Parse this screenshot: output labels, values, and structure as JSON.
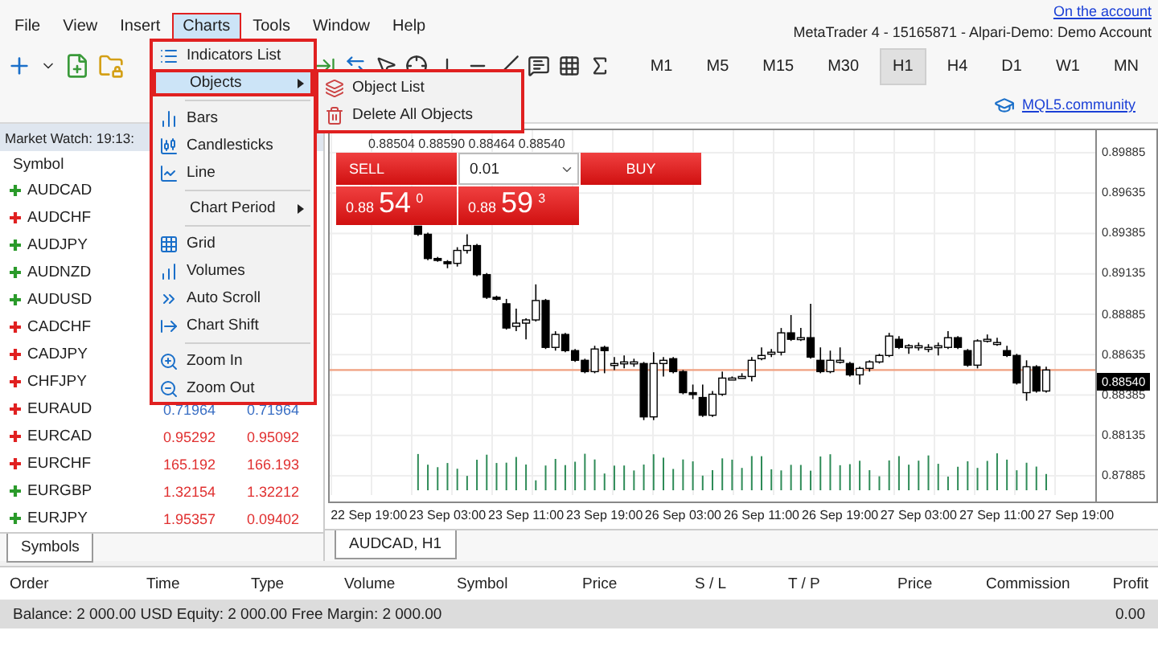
{
  "menu_bar": [
    {
      "label": "File",
      "selected": false
    },
    {
      "label": "View",
      "selected": false
    },
    {
      "label": "Insert",
      "selected": false
    },
    {
      "label": "Charts",
      "selected": true
    },
    {
      "label": "Tools",
      "selected": false
    },
    {
      "label": "Window",
      "selected": false
    },
    {
      "label": "Help",
      "selected": false
    }
  ],
  "account_link": "On the account",
  "window": {
    "title": "MetaTrader 4 - 15165871 - Alpari-Demo: Demo Account"
  },
  "timeframes": [
    {
      "label": "M1",
      "selected": false
    },
    {
      "label": "M5",
      "selected": false
    },
    {
      "label": "M15",
      "selected": false
    },
    {
      "label": "M30",
      "selected": false
    },
    {
      "label": "H1",
      "selected": true
    },
    {
      "label": "H4",
      "selected": false
    },
    {
      "label": "D1",
      "selected": false
    },
    {
      "label": "W1",
      "selected": false
    },
    {
      "label": "MN",
      "selected": false
    }
  ],
  "community_link": "MQL5.community",
  "market_watch": {
    "title": "Market Watch: 19:13:",
    "column": "Symbol",
    "rows": [
      {
        "symbol": "AUDCAD",
        "rising": true
      },
      {
        "symbol": "AUDCHF",
        "rising": false
      },
      {
        "symbol": "AUDJPY",
        "rising": true
      },
      {
        "symbol": "AUDNZD",
        "rising": true
      },
      {
        "symbol": "AUDUSD",
        "rising": true
      },
      {
        "symbol": "CADCHF",
        "rising": false
      },
      {
        "symbol": "CADJPY",
        "rising": false
      },
      {
        "symbol": "CHFJPY",
        "rising": false
      },
      {
        "symbol": "EURAUD",
        "rising": false,
        "bid": "0.71964",
        "ask": "0.71964",
        "color": "#3a6fc4"
      },
      {
        "symbol": "EURCAD",
        "rising": false,
        "bid": "0.95292",
        "ask": "0.95092",
        "color": "#e03030"
      },
      {
        "symbol": "EURCHF",
        "rising": false,
        "bid": "165.192",
        "ask": "166.193",
        "color": "#e03030"
      },
      {
        "symbol": "EURGBP",
        "rising": true,
        "bid": "1.32154",
        "ask": "1.32212",
        "color": "#e03030"
      },
      {
        "symbol": "EURJPY",
        "rising": true,
        "bid": "1.95357",
        "ask": "0.09402",
        "color": "#e03030"
      }
    ],
    "tab": "Symbols"
  },
  "charts_menu": [
    {
      "kind": "item",
      "label": "Indicators List",
      "selected": false
    },
    {
      "kind": "item",
      "label": "Objects",
      "submenu": true,
      "selected": true
    },
    {
      "kind": "separator"
    },
    {
      "kind": "item",
      "label": "Bars",
      "selected": false
    },
    {
      "kind": "item",
      "label": "Candlesticks",
      "selected": false
    },
    {
      "kind": "item",
      "label": "Line",
      "selected": false
    },
    {
      "kind": "separator"
    },
    {
      "kind": "item",
      "label": "Chart Period",
      "submenu": true,
      "selected": false
    },
    {
      "kind": "separator"
    },
    {
      "kind": "item",
      "label": "Grid",
      "selected": false
    },
    {
      "kind": "item",
      "label": "Volumes",
      "selected": false
    },
    {
      "kind": "item",
      "label": "Auto Scroll",
      "selected": false
    },
    {
      "kind": "item",
      "label": "Chart Shift",
      "selected": false
    },
    {
      "kind": "separator"
    },
    {
      "kind": "item",
      "label": "Zoom In",
      "selected": false
    },
    {
      "kind": "item",
      "label": "Zoom Out",
      "selected": false
    }
  ],
  "objects_submenu": [
    {
      "label": "Object List"
    },
    {
      "label": "Delete All Objects"
    }
  ],
  "chart": {
    "ohlc": "0.88504 0.88590 0.88464 0.88540",
    "trade_panel": {
      "sell": "SELL",
      "lot": "0.01",
      "buy": "BUY",
      "bid": {
        "prefix": "0.88",
        "big": "54",
        "small": "0"
      },
      "ask": {
        "prefix": "0.88",
        "big": "59",
        "small": "3"
      }
    },
    "current_price": "0.88540",
    "chart_data": {
      "type": "candlestick",
      "grid": true,
      "ref_lines": [
        {
          "axis": "y",
          "value": 0.8854,
          "color": "#f0a080"
        }
      ],
      "ylim": [
        0.87766,
        0.90024
      ],
      "categories": [
        null,
        null,
        null,
        null,
        "22 Sep 19:00",
        null,
        null,
        null,
        null,
        null,
        null,
        null,
        "23 Sep 03:00",
        null,
        null,
        null,
        null,
        null,
        null,
        null,
        "23 Sep 11:00",
        null,
        null,
        null,
        null,
        null,
        null,
        null,
        "23 Sep 19:00",
        null,
        null,
        null,
        null,
        null,
        null,
        null,
        "26 Sep 03:00",
        null,
        null,
        null,
        null,
        null,
        null,
        null,
        "26 Sep 11:00",
        null,
        null,
        null,
        null,
        null,
        null,
        null,
        "26 Sep 19:00",
        null,
        null,
        null,
        null,
        null,
        null,
        null,
        "27 Sep 03:00",
        null,
        null,
        null,
        null,
        null,
        null,
        null,
        "27 Sep 11:00",
        null,
        null,
        null,
        null,
        null,
        null,
        null,
        "27 Sep 19:00",
        null,
        null
      ],
      "ohlc": [
        null,
        null,
        null,
        null,
        null,
        null,
        null,
        null,
        null,
        [
          0.8943,
          0.8943,
          0.8937,
          0.8938
        ],
        [
          0.8938,
          0.8939,
          0.8922,
          0.8923
        ],
        [
          0.8923,
          0.8924,
          0.8921,
          0.8922
        ],
        [
          0.8921,
          0.8922,
          0.8917,
          0.892
        ],
        [
          0.892,
          0.893,
          0.8918,
          0.8928
        ],
        [
          0.8928,
          0.8938,
          0.8926,
          0.8931
        ],
        [
          0.8931,
          0.8932,
          0.8912,
          0.8913
        ],
        [
          0.8913,
          0.8914,
          0.8898,
          0.8899
        ],
        [
          0.8899,
          0.89,
          0.8897,
          0.8898
        ],
        [
          0.8895,
          0.8898,
          0.8879,
          0.888
        ],
        [
          0.8881,
          0.8892,
          0.8878,
          0.8883
        ],
        [
          0.8883,
          0.8886,
          0.8873,
          0.8885
        ],
        [
          0.8885,
          0.8907,
          0.8884,
          0.8897
        ],
        [
          0.8897,
          0.8898,
          0.8867,
          0.8868
        ],
        [
          0.8868,
          0.8878,
          0.8866,
          0.8876
        ],
        [
          0.8876,
          0.8877,
          0.8865,
          0.8866
        ],
        [
          0.8866,
          0.8867,
          0.8859,
          0.886
        ],
        [
          0.886,
          0.8861,
          0.8852,
          0.8853
        ],
        [
          0.8853,
          0.8869,
          0.8852,
          0.8867
        ],
        [
          0.8868,
          0.8869,
          0.8852,
          0.8866
        ],
        [
          0.8858,
          0.8862,
          0.8854,
          0.8858
        ],
        [
          0.8859,
          0.8863,
          0.8855,
          0.8859
        ],
        [
          0.8859,
          0.8861,
          0.8856,
          0.8859
        ],
        [
          0.8858,
          0.8859,
          0.8823,
          0.8825
        ],
        [
          0.8825,
          0.8865,
          0.8823,
          0.8858
        ],
        [
          0.8858,
          0.8862,
          0.885,
          0.886
        ],
        [
          0.8861,
          0.8862,
          0.8852,
          0.8853
        ],
        [
          0.8853,
          0.8854,
          0.8839,
          0.884
        ],
        [
          0.884,
          0.8845,
          0.8836,
          0.8839
        ],
        [
          0.8837,
          0.8845,
          0.8825,
          0.8826
        ],
        [
          0.8826,
          0.8841,
          0.8825,
          0.8839
        ],
        [
          0.8839,
          0.8853,
          0.8838,
          0.8849
        ],
        [
          0.8849,
          0.885,
          0.8848,
          0.8849
        ],
        [
          0.885,
          0.8852,
          0.8849,
          0.885
        ],
        [
          0.885,
          0.8862,
          0.8847,
          0.886
        ],
        [
          0.8861,
          0.8868,
          0.886,
          0.8863
        ],
        [
          0.8865,
          0.8867,
          0.8862,
          0.8865
        ],
        [
          0.8865,
          0.888,
          0.8863,
          0.8877
        ],
        [
          0.8877,
          0.8888,
          0.8872,
          0.8873
        ],
        [
          0.8874,
          0.888,
          0.8872,
          0.8874
        ],
        [
          0.8874,
          0.8895,
          0.8861,
          0.8862
        ],
        [
          0.886,
          0.8868,
          0.8852,
          0.8853
        ],
        [
          0.8853,
          0.8866,
          0.8852,
          0.886
        ],
        [
          0.886,
          0.8868,
          0.8858,
          0.886
        ],
        [
          0.8858,
          0.8859,
          0.885,
          0.8851
        ],
        [
          0.8851,
          0.8856,
          0.8845,
          0.8855
        ],
        [
          0.8855,
          0.886,
          0.8853,
          0.8859
        ],
        [
          0.8859,
          0.8864,
          0.8858,
          0.8863
        ],
        [
          0.8863,
          0.8877,
          0.8862,
          0.8875
        ],
        [
          0.8873,
          0.8875,
          0.8867,
          0.8868
        ],
        [
          0.8868,
          0.887,
          0.8864,
          0.8869
        ],
        [
          0.8869,
          0.8871,
          0.8866,
          0.8869
        ],
        [
          0.8868,
          0.887,
          0.8865,
          0.8868
        ],
        [
          0.8869,
          0.8871,
          0.8863,
          0.8869
        ],
        [
          0.8868,
          0.8878,
          0.8867,
          0.8874
        ],
        [
          0.8874,
          0.8875,
          0.8867,
          0.8868
        ],
        [
          0.8866,
          0.8867,
          0.8856,
          0.8857
        ],
        [
          0.8857,
          0.8873,
          0.8855,
          0.8872
        ],
        [
          0.8873,
          0.8876,
          0.8871,
          0.8873
        ],
        [
          0.8871,
          0.8874,
          0.8869,
          0.8871
        ],
        [
          0.8866,
          0.8869,
          0.8862,
          0.8863
        ],
        [
          0.8863,
          0.8864,
          0.8845,
          0.8846
        ],
        [
          0.884,
          0.886,
          0.8835,
          0.8856
        ],
        [
          0.8856,
          0.8857,
          0.884,
          0.8841
        ],
        [
          0.8841,
          0.8856,
          0.884,
          0.8854
        ],
        null,
        null,
        null,
        null,
        null
      ],
      "yticks": [
        0.89885,
        0.89635,
        0.89385,
        0.89135,
        0.88885,
        0.88635,
        0.88385,
        0.88135,
        0.87885
      ]
    },
    "tab": "AUDCAD, H1"
  },
  "terminal": {
    "columns": [
      "Order",
      "Time",
      "Type",
      "Volume",
      "Symbol",
      "Price",
      "S / L",
      "T / P",
      "Price",
      "Commission",
      "Profit"
    ],
    "balance": "Balance: 2 000.00 USD  Equity: 2 000.00  Free Margin: 2 000.00",
    "profit": "0.00"
  }
}
